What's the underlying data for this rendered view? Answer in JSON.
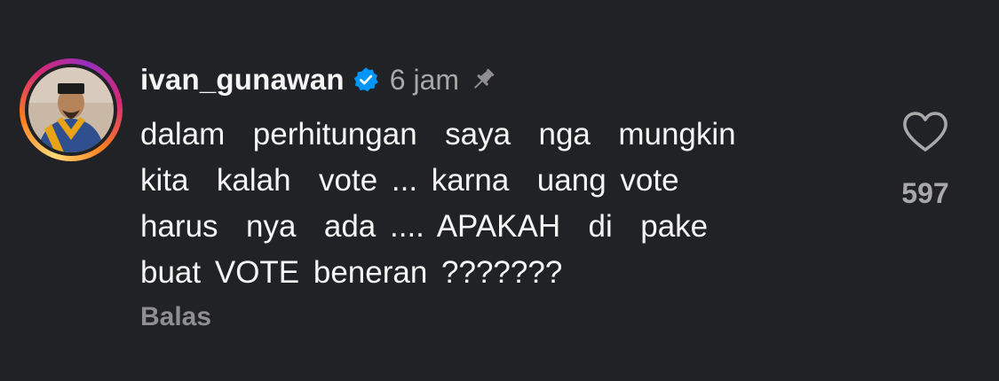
{
  "comment": {
    "username": "ivan_gunawan",
    "verified": true,
    "time_ago": "6 jam",
    "pinned": true,
    "text_lines": [
      "dalam  perhitungan  saya  nga  mungkin",
      "kita  kalah  vote ... karna  uang vote",
      "harus  nya  ada .... APAKAH  di  pake",
      "buat VOTE beneran ???????"
    ],
    "reply_label": "Balas",
    "like_count": "597"
  },
  "icons": {
    "verified": "verified-badge-icon",
    "pin": "pin-icon",
    "like": "heart-outline-icon"
  },
  "colors": {
    "background": "#212226",
    "text_primary": "#f5f5f5",
    "text_secondary": "#a8a8a8",
    "verified_blue": "#0095f6"
  }
}
